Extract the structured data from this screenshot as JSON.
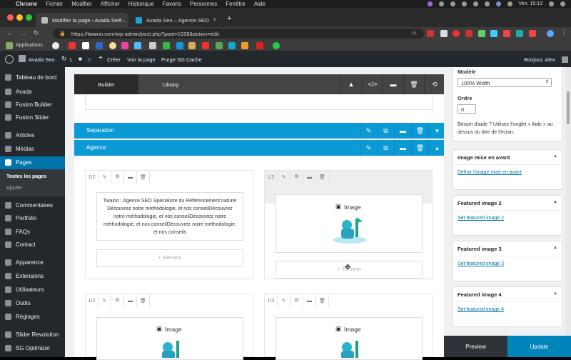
{
  "macos_menubar": {
    "app": "Chrome",
    "menus": [
      "Fichier",
      "Modifier",
      "Afficher",
      "Historique",
      "Favoris",
      "Personnes",
      "Fenêtre",
      "Aide"
    ],
    "clock": "Ven. 15:13"
  },
  "browser": {
    "tabs": [
      {
        "title": "Modifier la page ‹ Avada Seo –",
        "active": true
      },
      {
        "title": "Avada Seo – Agence SEO",
        "active": false
      }
    ],
    "new_tab": "+",
    "url": "https://twaino.com/wp-admin/post.php?post=1028&action=edit",
    "bookmarks_label": "Applications"
  },
  "wp_adminbar": {
    "site_name": "Avada Seo",
    "updates_count": "1",
    "comments_count": "0",
    "new_label": "Créer",
    "view_label": "Voir la page",
    "purge_label": "Purge SG Cache",
    "greeting": "Bonjour, Alex"
  },
  "sidebar": {
    "items": [
      {
        "label": "Tableau de bord",
        "icon": "dashboard-icon"
      },
      {
        "label": "Avada",
        "icon": "avada-icon"
      },
      {
        "label": "Fusion Builder",
        "icon": "fusion-builder-icon"
      },
      {
        "label": "Fusion Slider",
        "icon": "fusion-slider-icon"
      },
      {
        "label": "Articles",
        "icon": "pin-icon"
      },
      {
        "label": "Médias",
        "icon": "media-icon"
      },
      {
        "label": "Pages",
        "icon": "pages-icon",
        "current": true
      },
      {
        "label": "Commentaires",
        "icon": "comment-icon"
      },
      {
        "label": "Portfolio",
        "icon": "portfolio-icon"
      },
      {
        "label": "FAQs",
        "icon": "faq-icon"
      },
      {
        "label": "Contact",
        "icon": "mail-icon"
      },
      {
        "label": "Apparence",
        "icon": "brush-icon"
      },
      {
        "label": "Extensions",
        "icon": "plugin-icon"
      },
      {
        "label": "Utilisateurs",
        "icon": "users-icon"
      },
      {
        "label": "Outils",
        "icon": "tools-icon"
      },
      {
        "label": "Réglages",
        "icon": "settings-icon"
      },
      {
        "label": "Slider Revolution",
        "icon": "slider-icon"
      },
      {
        "label": "SG Optimizer",
        "icon": "sg-icon"
      }
    ],
    "submenu": [
      "Toutes les pages",
      "Ajouter"
    ]
  },
  "builder": {
    "tab_builder": "Builder",
    "tab_library": "Library",
    "sections": [
      {
        "title": "Separation",
        "collapsed": true
      },
      {
        "title": "Agence",
        "collapsed": false
      }
    ],
    "column_size": "1/2",
    "text_element": "Twaino : Agence SEO Spécialiste du Référencement naturel Découvrez notre méthodologie, et nos conseilDécouvrez notre méthodologie, et nos conseilDécouvrez notre méthodologie, et nos conseilDécouvrez notre méthodologie, et nos conseils",
    "image_label": "Image",
    "add_element_label": "Element"
  },
  "right_panel": {
    "model_label": "Modèle",
    "model_value": "100% Width",
    "order_label": "Ordre",
    "order_value": "0",
    "help_text": "Besoin d’aide ? Utilisez l’onglet « Aide » au dessus du titre de l’écran.",
    "featured": [
      {
        "title": "Image mise en avant",
        "link": "Définir l’image mise en avant"
      },
      {
        "title": "Featured image 2",
        "link": "Set featured image 2"
      },
      {
        "title": "Featured image 3",
        "link": "Set featured image 3"
      },
      {
        "title": "Featured image 4",
        "link": "Set featured image 4"
      }
    ],
    "preview_label": "Preview",
    "update_label": "Update"
  },
  "colors": {
    "wp_dark": "#23282d",
    "wp_blue": "#0073aa",
    "section_blue": "#0c9ad6",
    "update_blue": "#0085ba"
  }
}
